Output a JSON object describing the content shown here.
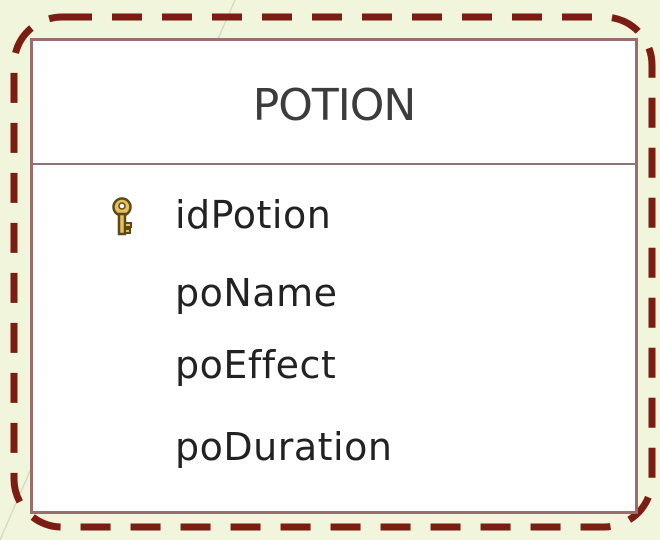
{
  "table": {
    "title": "POTION",
    "fields": [
      {
        "name": "idPotion",
        "icon": "key-icon"
      },
      {
        "name": "poName"
      },
      {
        "name": "poEffect"
      },
      {
        "name": "poDuration"
      }
    ]
  },
  "colors": {
    "background": "#f1f5dc",
    "highlight_border": "#7b1d12",
    "table_border": "#9a6e6e"
  }
}
